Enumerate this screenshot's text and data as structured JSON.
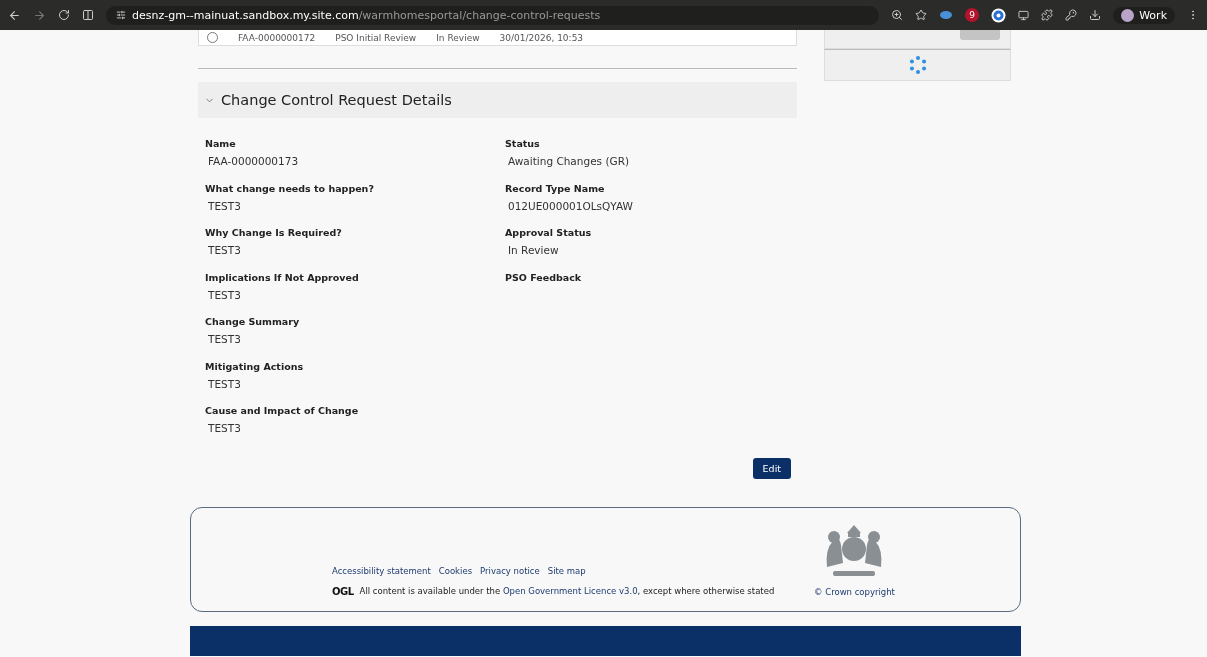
{
  "browser": {
    "url_host": "desnz-gm--mainuat.sandbox.my.site.com",
    "url_path": "/warmhomesportal/change-control-requests",
    "extension_badge": "9",
    "profile": "Work"
  },
  "request_row": {
    "selected": false,
    "cells": [
      "FAA-0000000172",
      "PSO Initial Review",
      "In Review",
      "30/01/2026, 10:53"
    ]
  },
  "details": {
    "title": "Change Control Request Details",
    "expanded": true,
    "left_fields": [
      {
        "label": "Name",
        "value": "FAA-0000000173"
      },
      {
        "label": "What change needs to happen?",
        "value": "TEST3"
      },
      {
        "label": "Why Change Is Required?",
        "value": "TEST3"
      },
      {
        "label": "Implications If Not Approved",
        "value": "TEST3"
      },
      {
        "label": "Change Summary",
        "value": "TEST3"
      },
      {
        "label": "Mitigating Actions",
        "value": "TEST3"
      },
      {
        "label": "Cause and Impact of Change",
        "value": "TEST3"
      }
    ],
    "right_fields": [
      {
        "label": "Status",
        "value": "Awaiting Changes (GR)"
      },
      {
        "label": "Record Type Name",
        "value": "012UE000001OLsQYAW"
      },
      {
        "label": "Approval Status",
        "value": "In Review"
      },
      {
        "label": "PSO Feedback"
      }
    ],
    "edit_button": "Edit"
  },
  "footer": {
    "links": [
      "Accessibility statement",
      "Cookies",
      "Privacy notice",
      "Site map"
    ],
    "ogl_logo": "OGL",
    "licence_before": "All content is available under the ",
    "licence_link": "Open Government Licence v3.0",
    "licence_after": ", except where otherwise stated",
    "copyright": "© Crown copyright"
  }
}
